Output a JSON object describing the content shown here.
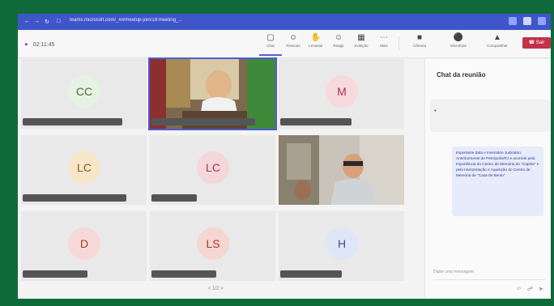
{
  "browser": {
    "url": "teams.microsoft.com/_#/l/meetup-join/19:meeting_..."
  },
  "toolbar": {
    "timer": "02:11:45",
    "items": [
      {
        "label": "Chat",
        "icon": "chat-icon"
      },
      {
        "label": "Pessoas",
        "icon": "people-icon"
      },
      {
        "label": "Levantar",
        "icon": "raise-hand-icon"
      },
      {
        "label": "Reagir",
        "icon": "react-icon"
      },
      {
        "label": "Exibição",
        "icon": "view-icon"
      },
      {
        "label": "Mais",
        "icon": "more-icon"
      }
    ],
    "media": [
      {
        "label": "Câmera",
        "icon": "camera-icon"
      },
      {
        "label": "Microfone",
        "icon": "microphone-icon"
      },
      {
        "label": "Compartilhar",
        "icon": "share-icon"
      }
    ],
    "leave": "Sair",
    "active_color": "#5b5fc7",
    "leave_color": "#c4314b"
  },
  "participants": [
    {
      "initials": "CC",
      "name": "",
      "bg": "#e6f3e2",
      "fg": "#4b6b3d"
    },
    {
      "initials": "",
      "name": "",
      "video": true,
      "selected": true
    },
    {
      "initials": "M",
      "name": "",
      "bg": "#f7d9de",
      "fg": "#a1364b"
    },
    {
      "initials": "LC",
      "name": "",
      "bg": "#f8e6c9",
      "fg": "#8a5a14"
    },
    {
      "initials": "LC",
      "name": "",
      "bg": "#f4d7da",
      "fg": "#9a3b48"
    },
    {
      "initials": "",
      "name": "",
      "video": true
    },
    {
      "initials": "D",
      "name": "",
      "bg": "#f6d9d6",
      "fg": "#a23a2f"
    },
    {
      "initials": "LS",
      "name": "",
      "bg": "#f6d6d3",
      "fg": "#a8392e"
    },
    {
      "initials": "H",
      "name": "",
      "bg": "#dfe6f7",
      "fg": "#36508f"
    }
  ],
  "pager": "< 1/2 >",
  "chat": {
    "title": "Chat da reunião",
    "system_header": "",
    "system_text": "",
    "message": "Importante data e Inventário Judiciário; Anteriormente de Petrópolis/RJ e ocorrido pela Importância do Centro de Memória do \"Capela\" e pela Interpretação e Aquisição do Centro de Memória de \"Casa de Bento\"",
    "compose_placeholder": "Digite uma mensagem"
  }
}
